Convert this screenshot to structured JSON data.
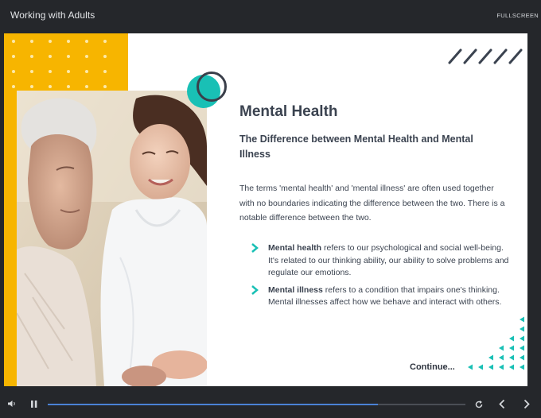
{
  "window": {
    "title": "Working with Adults",
    "fullscreen_label": "FULLSCREEN"
  },
  "slide": {
    "title": "Mental Health",
    "subtitle": "The Difference between Mental Health and Mental Illness",
    "intro": "The terms 'mental health' and 'mental illness' are often used together with no boundaries indicating the difference between the two. There is a notable difference between the two.",
    "bullets": [
      {
        "term": "Mental health",
        "text": " refers to our psychological and social well-being. It's related to our thinking ability, our ability to solve problems and regulate our emotions."
      },
      {
        "term": "Mental illness",
        "text": " refers to a condition that impairs one's thinking. Mental illnesses affect how we behave and interact with others."
      }
    ],
    "continue_label": "Continue...",
    "image": "photo of a young caregiver in white uniform smiling beside an elderly man",
    "colors": {
      "accent_yellow": "#f7b500",
      "accent_teal": "#19c0b5",
      "heading": "#3b4350",
      "progress": "#4a82d6"
    }
  },
  "player": {
    "progress_fraction": 0.79,
    "icons": {
      "volume": "volume-icon",
      "pause": "pause-icon",
      "replay": "replay-icon",
      "previous": "chevron-left-icon",
      "next": "chevron-right-icon"
    }
  }
}
